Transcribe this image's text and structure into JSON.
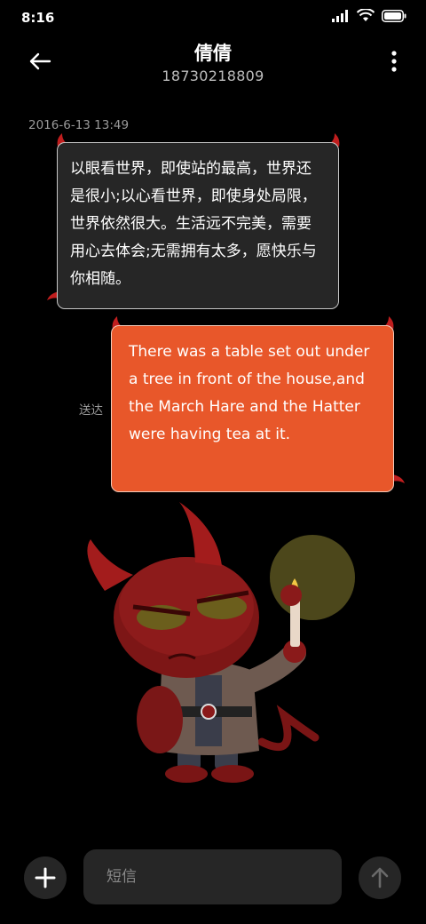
{
  "status_bar": {
    "time": "8:16",
    "icons": [
      "signal-icon",
      "wifi-icon",
      "battery-icon"
    ]
  },
  "header": {
    "title": "倩倩",
    "subtitle": "18730218809",
    "back_icon": "back-arrow-icon",
    "more_icon": "more-vertical-icon"
  },
  "conversation": {
    "timestamp": "2016-6-13 13:49",
    "incoming_message": "以眼看世界，即使站的最高，世界还是很小;以心看世界，即使身处局限，世界依然很大。生活远不完美，需要用心去体会;无需拥有太多，愿快乐与你相随。",
    "outgoing_message": "There was a table set out under a tree in front of the house,and the March Hare and the Hatter were having tea at it.",
    "outgoing_status": "送达"
  },
  "input_bar": {
    "placeholder": "短信",
    "add_icon": "plus-icon",
    "send_icon": "send-arrow-icon"
  },
  "colors": {
    "background": "#000000",
    "incoming_bubble": "#262626",
    "outgoing_bubble": "#e8572a",
    "horn": "#c01e1e"
  }
}
